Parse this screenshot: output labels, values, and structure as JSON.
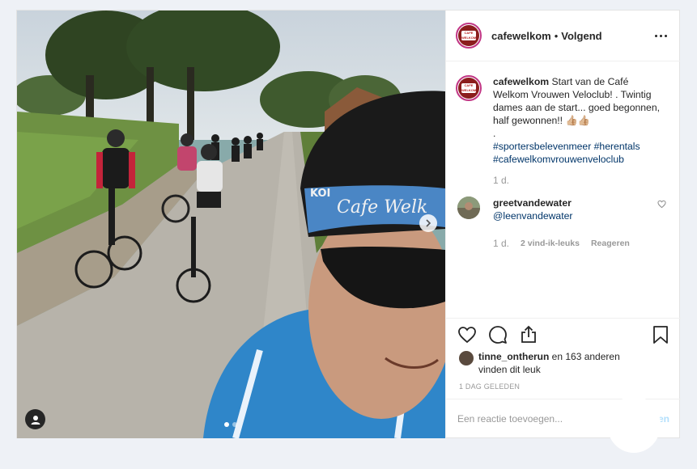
{
  "post": {
    "username": "cafewelkom",
    "separator": "•",
    "follow_label": "Volgend",
    "avatar_badge": "CAFE WELKOM",
    "caption": {
      "username": "cafewelkom",
      "text": " Start van de Café Welkom Vrouwen Veloclub! . Twintig dames aan de start... goed begonnen, half gewonnen!! 👍🏼👍🏼",
      "dot": ".",
      "hashtags": [
        "#sportersbelevenmeer",
        "#herentals",
        "#cafewelkomvrouwenveloclub"
      ],
      "time": "1 d."
    },
    "photo": {
      "helmet_text": "Cafe Welk",
      "helmet_brand": "KOI"
    },
    "comment": {
      "username": "greetvandewater",
      "mention": "@leenvandewater",
      "time": "1 d.",
      "likes": "2 vind-ik-leuks",
      "reply": "Reageren"
    },
    "likes": {
      "user": "tinne_ontherun",
      "rest": " en 163 anderen",
      "line2": "vinden dit leuk"
    },
    "time_ago": "1 DAG GELEDEN",
    "comment_placeholder": "Een reactie toevoegen...",
    "post_button": "Plaatsen"
  },
  "icons": [
    "more-icon",
    "heart-icon",
    "comment-icon",
    "share-icon",
    "bookmark-icon",
    "chevron-right-icon",
    "user-tag-icon"
  ],
  "colors": {
    "hashtag": "#003569",
    "meta": "#999999",
    "post_button": "#b2dffc"
  }
}
